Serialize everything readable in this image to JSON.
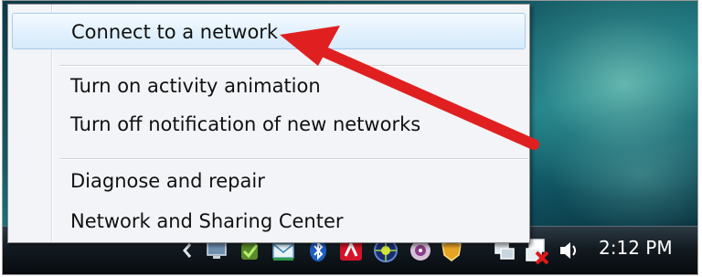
{
  "context_menu": {
    "items": [
      {
        "label": "Connect to a network"
      },
      {
        "label": "Turn on activity animation"
      },
      {
        "label": "Turn off notification of new networks"
      },
      {
        "label": "Diagnose and repair"
      },
      {
        "label": "Network and Sharing Center"
      }
    ]
  },
  "taskbar": {
    "clock": "2:12 PM",
    "tray_icons": [
      "chevron-left-icon",
      "display-icon",
      "checkmark-shield-icon",
      "mail-icon",
      "bluetooth-icon",
      "red-app-icon",
      "globe-icon",
      "media-disc-icon",
      "security-shield-icon",
      "network-icon",
      "network-disconnected-icon",
      "speaker-icon"
    ]
  },
  "colors": {
    "arrow": "#e02020",
    "hover_highlight": "#d6eafb",
    "taskbar": "#121a20"
  }
}
